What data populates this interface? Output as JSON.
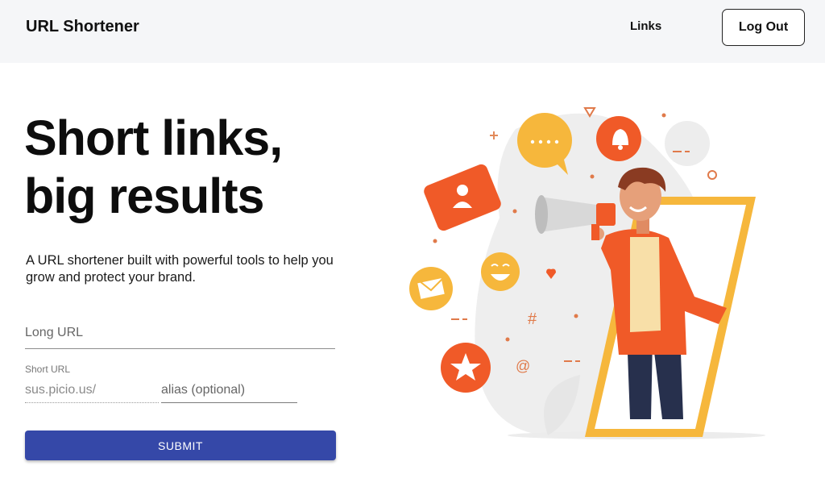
{
  "header": {
    "brand": "URL Shortener",
    "nav_links": "Links",
    "logout": "Log Out"
  },
  "hero": {
    "title_line1": "Short links,",
    "title_line2": "big results",
    "subtitle": "A URL shortener built with powerful tools to help you grow and protect your brand."
  },
  "form": {
    "long_url_placeholder": "Long URL",
    "short_url_label": "Short URL",
    "short_url_prefix": "sus.picio.us/",
    "alias_placeholder": "alias (optional)",
    "submit": "SUBMIT"
  },
  "illustration": {
    "hashtag": "#",
    "at_sign": "@"
  },
  "colors": {
    "accent_button": "#3548a8",
    "illus_orange": "#f05a28",
    "illus_yellow": "#f6b73c"
  }
}
